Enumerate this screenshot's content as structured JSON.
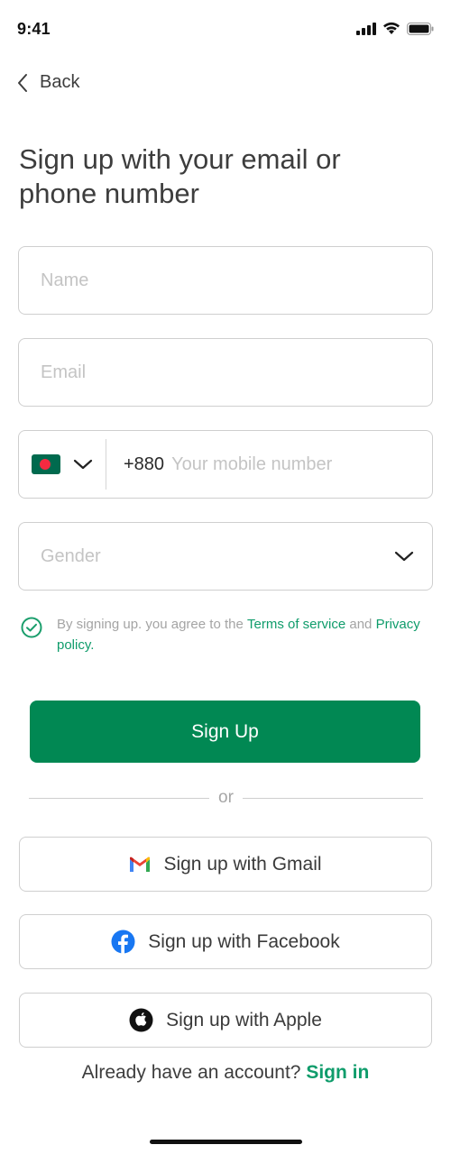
{
  "status_bar": {
    "time": "9:41"
  },
  "nav": {
    "back_label": "Back"
  },
  "title": "Sign up with your email or phone number",
  "form": {
    "name_placeholder": "Name",
    "email_placeholder": "Email",
    "phone_code": "+880",
    "phone_placeholder": "Your mobile number",
    "gender_placeholder": "Gender"
  },
  "terms": {
    "prefix": "By signing up. you agree to the ",
    "terms_link": "Terms of service",
    "middle": " and ",
    "privacy_link": "Privacy policy."
  },
  "buttons": {
    "signup": "Sign Up",
    "divider": "or",
    "gmail": "Sign up with Gmail",
    "facebook": "Sign up with Facebook",
    "apple": "Sign up with Apple"
  },
  "footer": {
    "prompt": "Already have an account? ",
    "signin_link": "Sign in"
  },
  "colors": {
    "primary": "#018853",
    "link": "#0f9c6b",
    "border": "#cfcfcf",
    "placeholder": "#c4c4c4"
  }
}
